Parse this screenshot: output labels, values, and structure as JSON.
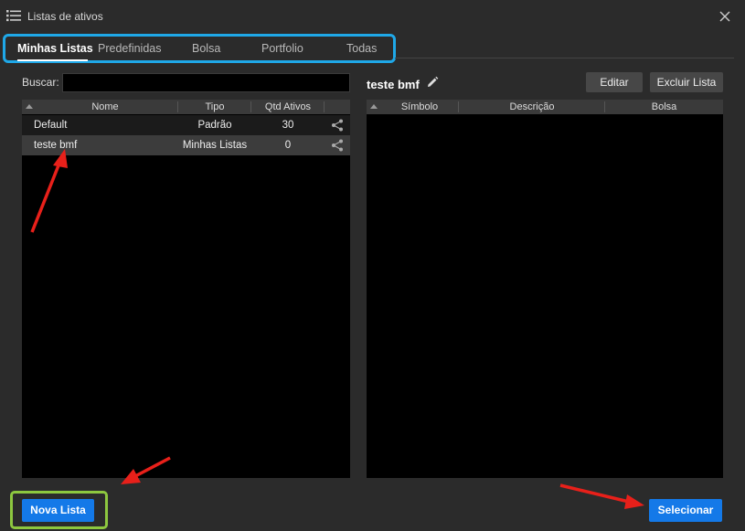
{
  "window": {
    "title": "Listas de ativos"
  },
  "tabs": [
    {
      "label": "Minhas Listas",
      "active": true
    },
    {
      "label": "Predefinidas"
    },
    {
      "label": "Bolsa"
    },
    {
      "label": "Portfolio"
    },
    {
      "label": "Todas"
    }
  ],
  "search": {
    "label": "Buscar:",
    "value": ""
  },
  "lists_table": {
    "columns": [
      "Nome",
      "Tipo",
      "Qtd Ativos"
    ],
    "rows": [
      {
        "nome": "Default",
        "tipo": "Padrão",
        "qtd": "30"
      },
      {
        "nome": "teste bmf",
        "tipo": "Minhas Listas",
        "qtd": "0",
        "selected": true
      }
    ]
  },
  "detail": {
    "list_name": "teste bmf",
    "edit_label": "Editar",
    "delete_label": "Excluir Lista",
    "columns": [
      "Símbolo",
      "Descrição",
      "Bolsa"
    ]
  },
  "footer": {
    "new_list_label": "Nova Lista",
    "select_label": "Selecionar"
  },
  "colors": {
    "background": "#2b2b2b",
    "tab_highlight": "#1fa8e8",
    "new_list_highlight": "#8dc73f",
    "primary_button": "#1479e8",
    "annotation_arrow": "#e8201a"
  }
}
